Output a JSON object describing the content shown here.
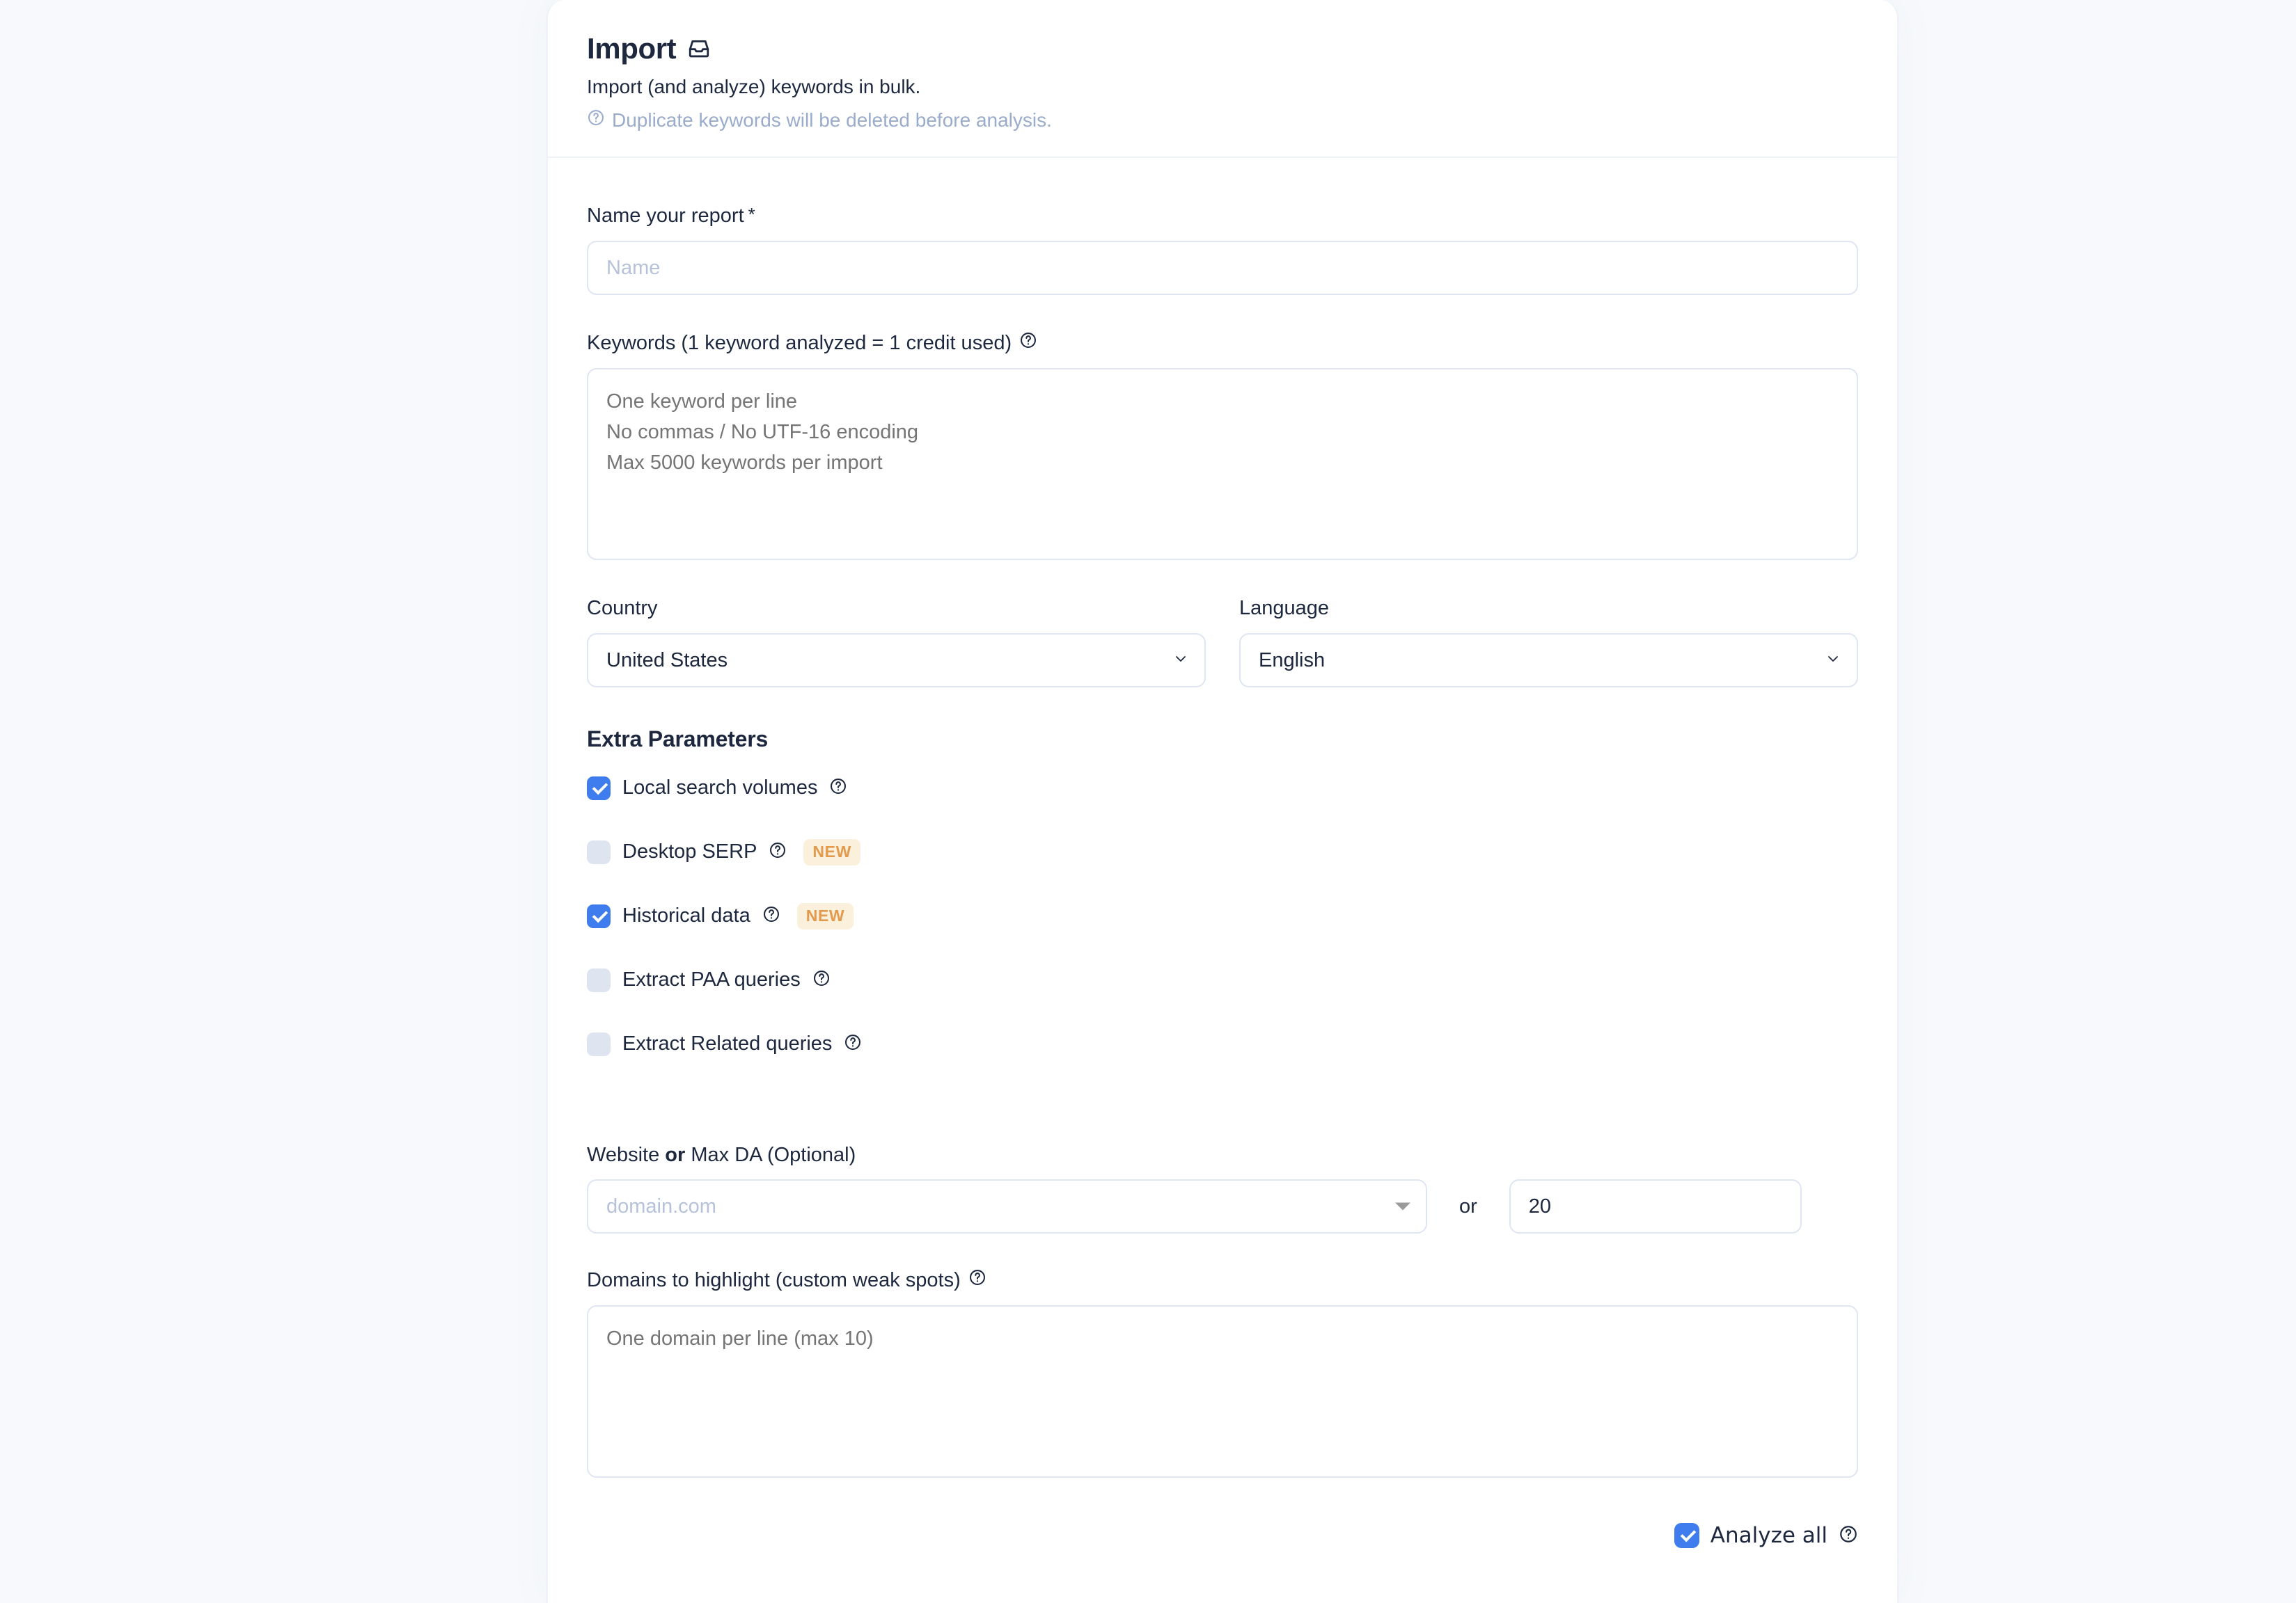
{
  "page": {
    "background_color": "#f7f9fc",
    "card_background": "#ffffff",
    "accent_color": "#3f7ced",
    "badge_bg_color": "#fbf0dc",
    "badge_text_color": "#e49a4c",
    "text_color": "#1d283f",
    "muted_text_color": "#9aaccb",
    "placeholder_color": "#b6c2da",
    "border_color": "#dfe6f2"
  },
  "header": {
    "title": "Import",
    "title_icon": "inbox-icon",
    "subtitle": "Import (and analyze) keywords in bulk.",
    "note_icon": "help-circle-icon",
    "note": "Duplicate keywords will be deleted before analysis."
  },
  "form": {
    "report_name": {
      "label": "Name your report",
      "required_marker": "*",
      "value": "",
      "placeholder": "Name"
    },
    "keywords": {
      "label": "Keywords (1 keyword analyzed = 1 credit used)",
      "help_icon": "help-circle-icon",
      "value": "",
      "placeholder": "One keyword per line\nNo commas / No UTF-16 encoding\nMax 5000 keywords per import"
    },
    "country": {
      "label": "Country",
      "value": "United States",
      "options": [
        "United States"
      ],
      "chevron_icon": "chevron-down-icon"
    },
    "language": {
      "label": "Language",
      "value": "English",
      "options": [
        "English"
      ],
      "chevron_icon": "chevron-down-icon"
    },
    "extra_parameters": {
      "title": "Extra Parameters",
      "options": [
        {
          "label": "Local search volumes",
          "checked": true,
          "help_icon": "help-circle-icon",
          "badge": ""
        },
        {
          "label": "Desktop SERP",
          "checked": false,
          "help_icon": "help-circle-icon",
          "badge": "NEW"
        },
        {
          "label": "Historical data",
          "checked": true,
          "help_icon": "help-circle-icon",
          "badge": "NEW"
        },
        {
          "label": "Extract PAA queries",
          "checked": false,
          "help_icon": "help-circle-icon",
          "badge": ""
        },
        {
          "label": "Extract Related queries",
          "checked": false,
          "help_icon": "help-circle-icon",
          "badge": ""
        }
      ]
    },
    "website_or_da": {
      "label_part1": "Website ",
      "label_bold": "or",
      "label_part2": " Max DA (Optional)",
      "website": {
        "value": "",
        "placeholder": "domain.com",
        "caret_icon": "caret-down-icon"
      },
      "separator": "or",
      "max_da": {
        "value": "20",
        "placeholder": ""
      }
    },
    "domains_to_highlight": {
      "label": "Domains to highlight (custom weak spots)",
      "help_icon": "help-circle-icon",
      "value": "",
      "placeholder": "One domain per line (max 10)"
    },
    "analyze_all": {
      "label": "Analyze all",
      "checked": true,
      "help_icon": "help-circle-icon"
    }
  }
}
